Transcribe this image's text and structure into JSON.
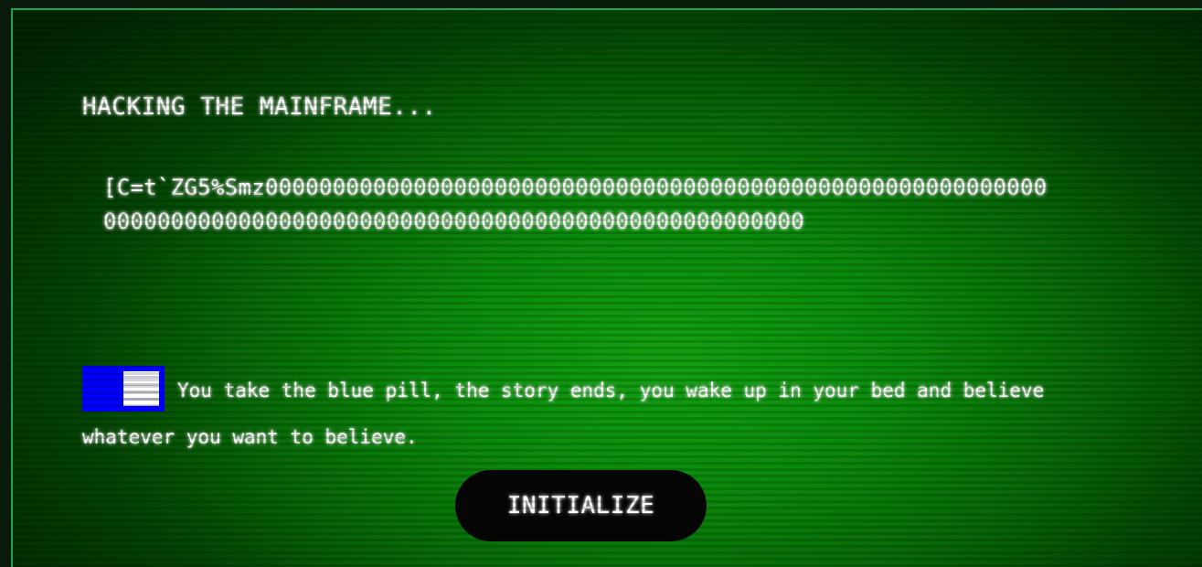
{
  "header": {
    "title": "HACKING THE MAINFRAME..."
  },
  "hash_output": "[C=t`ZG5%Smz00000000000000000000000000000000000000000000000000000000000000000000000000000000000000000000000000000000000000",
  "story": {
    "icon": "blue-pill-icon",
    "text": "You take the blue pill, the story ends, you wake up in your bed and believe whatever you want to believe."
  },
  "actions": {
    "initialize_label": "INITIALIZE"
  },
  "colors": {
    "screen_green": "#0a8a0a",
    "border": "#1aa55a",
    "pill_blue": "#0000ff",
    "button_bg": "#050505",
    "text": "#ffffff"
  }
}
